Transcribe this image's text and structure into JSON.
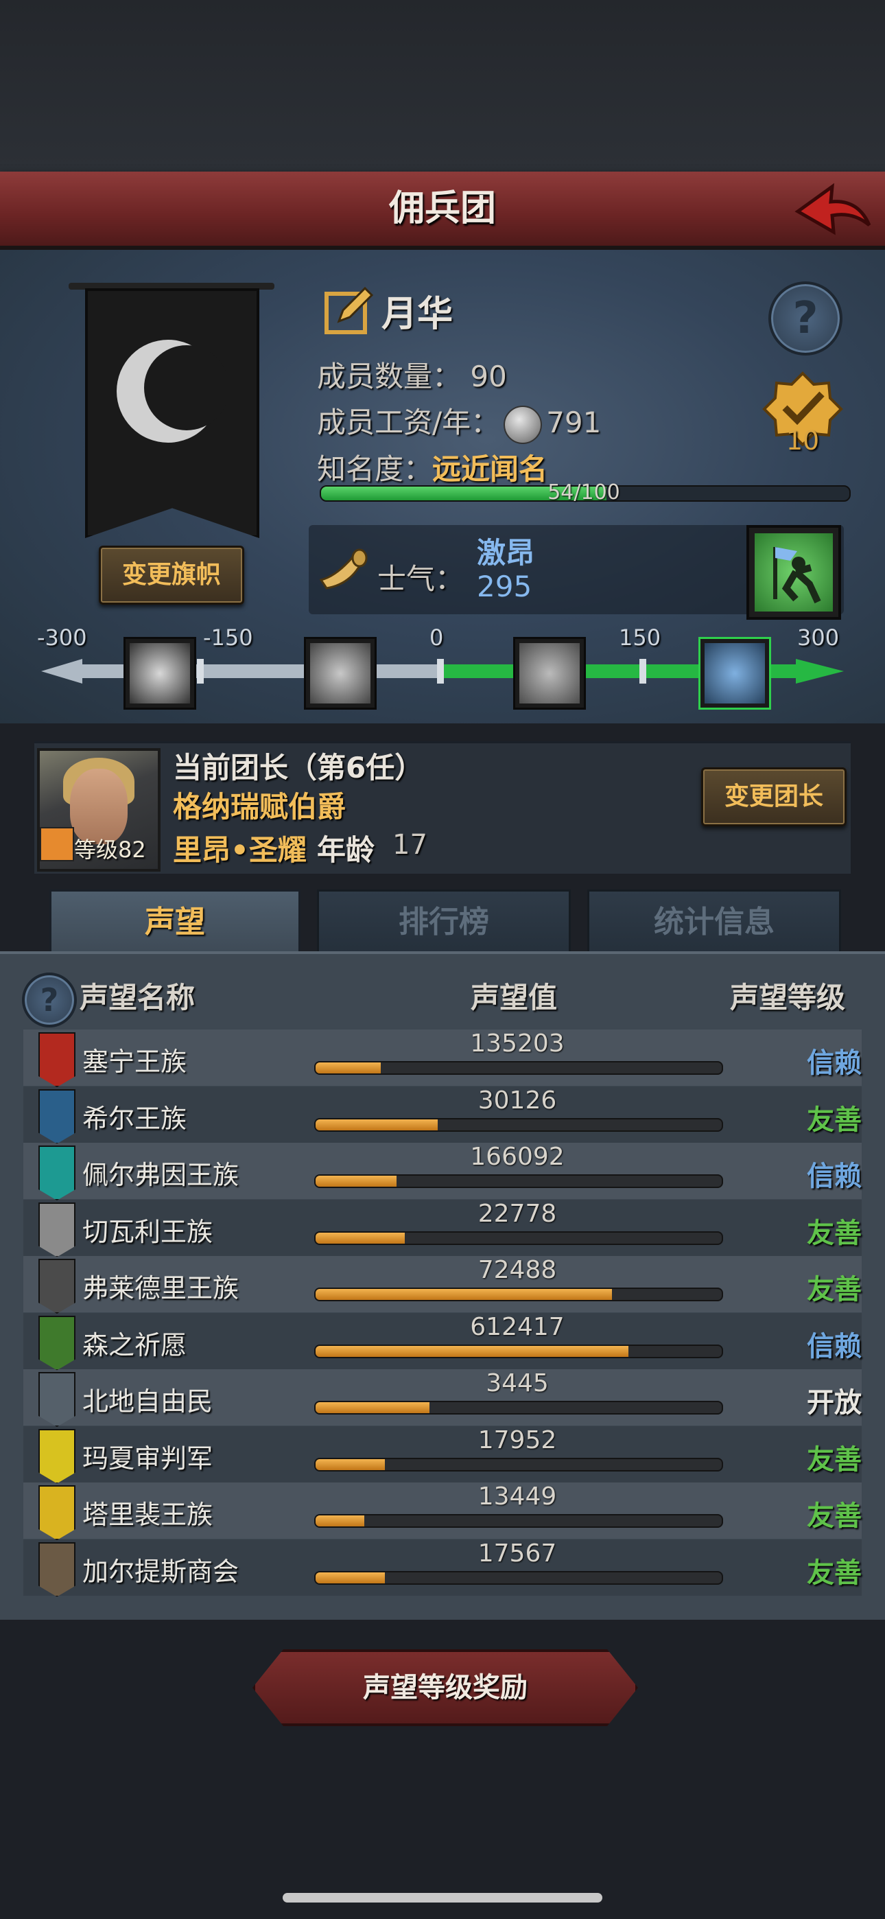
{
  "header": {
    "title": "佣兵团",
    "back_icon": "back-arrow-icon"
  },
  "guild": {
    "name": "月华",
    "members_label": "成员数量：",
    "members_value": "90",
    "salary_label": "成员工资/年：",
    "salary_value": "791",
    "fame_label": "知名度：",
    "fame_value": "远近闻名",
    "fame_progress_text": "54/100",
    "fame_progress_fraction": 0.54,
    "medal_count": "10",
    "change_flag_button": "变更旗帜",
    "morale_label": "士气：",
    "morale_state": "激昂",
    "morale_value": "295",
    "morale_ticks": [
      "-300",
      "-150",
      "0",
      "150",
      "300"
    ]
  },
  "leader": {
    "title": "当前团长（第6任）",
    "name": "格纳瑞赋伯爵",
    "origin": "里昂•圣耀",
    "age_label": "年龄",
    "age": "17",
    "level_text": "等级82",
    "change_button": "变更团长"
  },
  "tabs": [
    {
      "label": "声望",
      "active": true
    },
    {
      "label": "排行榜",
      "active": false
    },
    {
      "label": "统计信息",
      "active": false
    }
  ],
  "table": {
    "col_name": "声望名称",
    "col_value": "声望值",
    "col_level": "声望等级",
    "rows": [
      {
        "name": "塞宁王族",
        "value": "135203",
        "fill": 0.16,
        "level": "信赖",
        "level_color": "#6fa7e0",
        "icon_color": "#b3291f"
      },
      {
        "name": "希尔王族",
        "value": "30126",
        "fill": 0.3,
        "level": "友善",
        "level_color": "#5fc24a",
        "icon_color": "#2a5f8a"
      },
      {
        "name": "佩尔弗因王族",
        "value": "166092",
        "fill": 0.2,
        "level": "信赖",
        "level_color": "#6fa7e0",
        "icon_color": "#1d9a92"
      },
      {
        "name": "切瓦利王族",
        "value": "22778",
        "fill": 0.22,
        "level": "友善",
        "level_color": "#5fc24a",
        "icon_color": "#8a8a8a"
      },
      {
        "name": "弗莱德里王族",
        "value": "72488",
        "fill": 0.73,
        "level": "友善",
        "level_color": "#5fc24a",
        "icon_color": "#4b4b4b"
      },
      {
        "name": "森之祈愿",
        "value": "612417",
        "fill": 0.77,
        "level": "信赖",
        "level_color": "#6fa7e0",
        "icon_color": "#3f7a2c"
      },
      {
        "name": "北地自由民",
        "value": "3445",
        "fill": 0.28,
        "level": "开放",
        "level_color": "#e8e6e0",
        "icon_color": "#55606a"
      },
      {
        "name": "玛夏审判军",
        "value": "17952",
        "fill": 0.17,
        "level": "友善",
        "level_color": "#5fc24a",
        "icon_color": "#d8c21f"
      },
      {
        "name": "塔里裴王族",
        "value": "13449",
        "fill": 0.12,
        "level": "友善",
        "level_color": "#5fc24a",
        "icon_color": "#d9b320"
      },
      {
        "name": "加尔提斯商会",
        "value": "17567",
        "fill": 0.17,
        "level": "友善",
        "level_color": "#5fc24a",
        "icon_color": "#6b5a45"
      }
    ]
  },
  "reward_button": "声望等级奖励"
}
